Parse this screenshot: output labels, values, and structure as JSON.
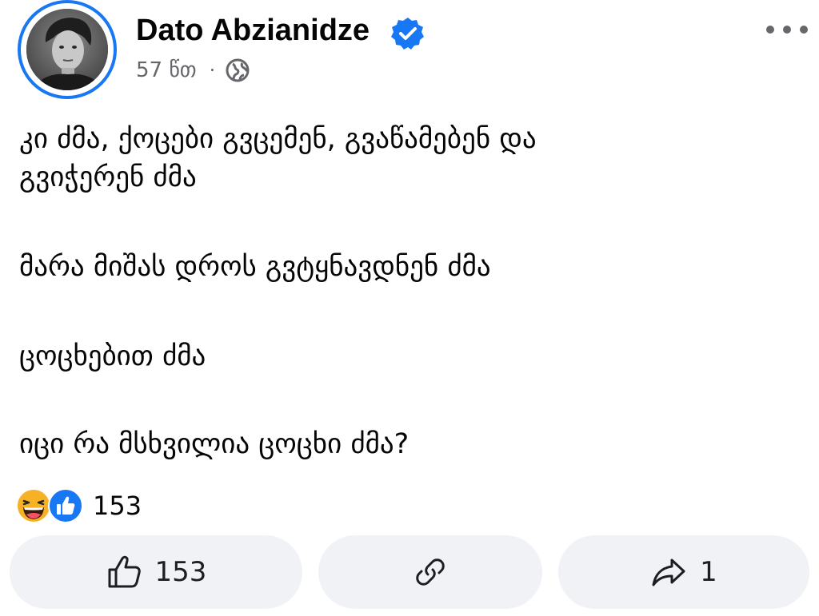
{
  "post": {
    "author": "Dato Abzianidze",
    "time": "57 წთ",
    "meta_separator": "·",
    "paragraphs": [
      "კი ძმა, ქოცები გვცემენ, გვაწამებენ და\nგვიჭერენ ძმა",
      "მარა მიშას დროს გვტყნავდნენ ძმა",
      "ცოცხებით ძმა",
      "იცი რა მსხვილია ცოცხი ძმა?"
    ]
  },
  "reactions": {
    "types": [
      "haha",
      "like"
    ],
    "count": "153"
  },
  "actions": {
    "like_count": "153",
    "share_count": "1"
  },
  "icons": {
    "verified": "verified-badge-icon",
    "globe": "globe-icon",
    "more": "more-horizontal-icon",
    "like": "thumbs-up-icon",
    "link": "link-icon",
    "share": "share-arrow-icon"
  },
  "colors": {
    "accent": "#1877f2",
    "text_primary": "#050505",
    "text_secondary": "#65676b",
    "pill_bg": "#f0f2f5",
    "haha_yellow": "#f7b125"
  }
}
